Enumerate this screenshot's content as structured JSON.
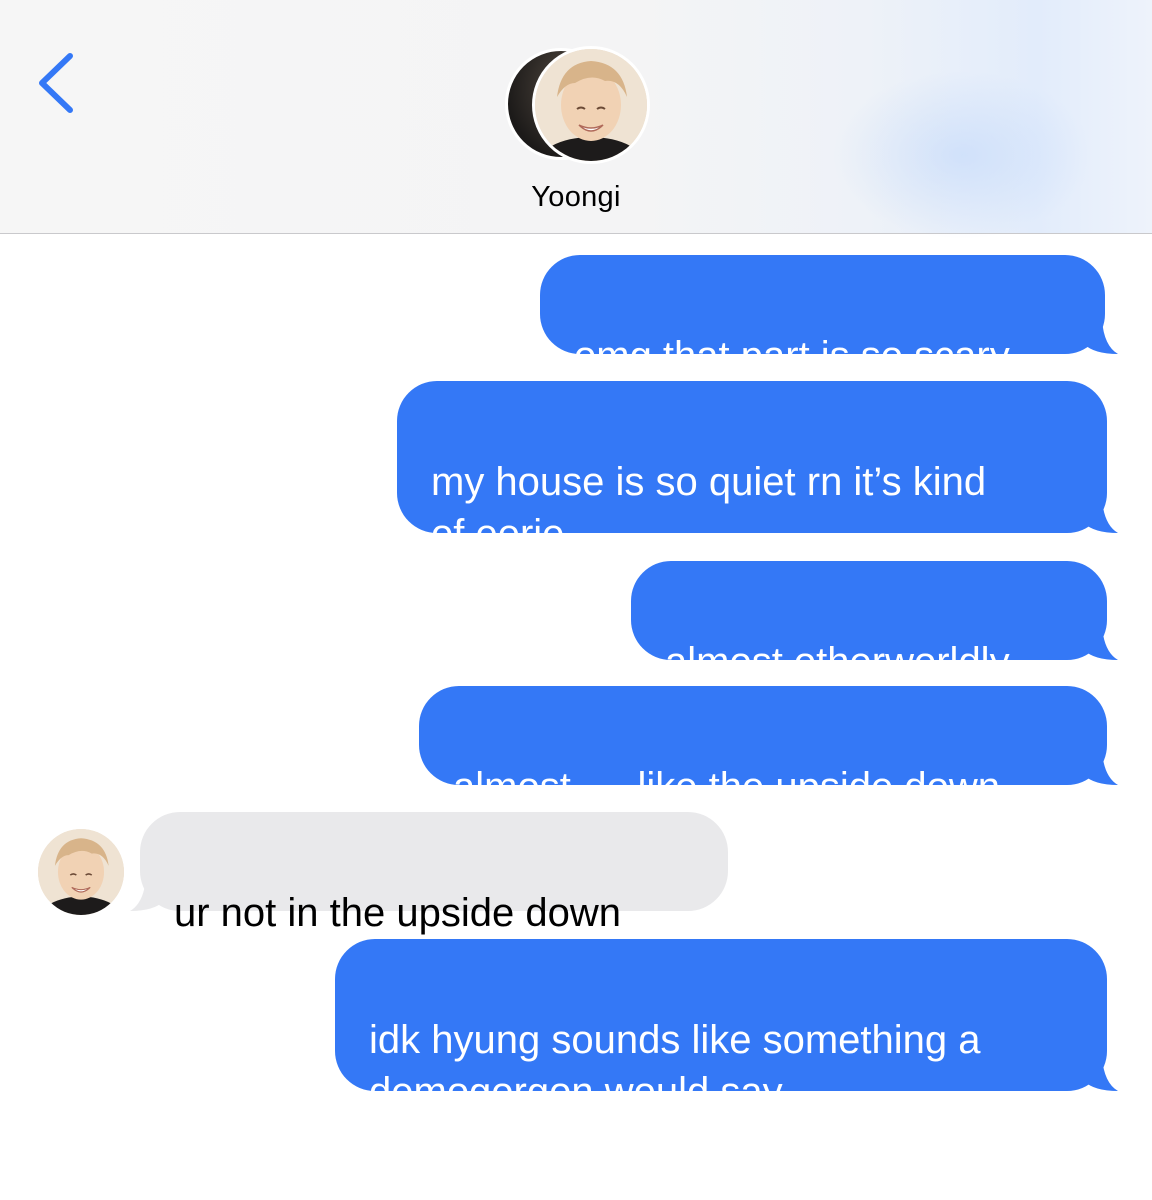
{
  "header": {
    "contact_name": "Yoongi",
    "back_icon": "chevron-left-icon",
    "accent_color": "#3478f6"
  },
  "messages": [
    {
      "direction": "outgoing",
      "text": "omg that part is so scary"
    },
    {
      "direction": "outgoing",
      "text": "my house is so quiet rn it’s kind\nof eerie"
    },
    {
      "direction": "outgoing",
      "text": "almost otherworldly"
    },
    {
      "direction": "outgoing",
      "text": "almost..... like the upside down"
    },
    {
      "direction": "incoming",
      "text": "ur not in the upside down"
    },
    {
      "direction": "outgoing",
      "text": "idk hyung sounds like something a\ndemogorgon would say"
    }
  ],
  "colors": {
    "outgoing_bubble": "#3478f6",
    "incoming_bubble": "#e9e9eb"
  }
}
